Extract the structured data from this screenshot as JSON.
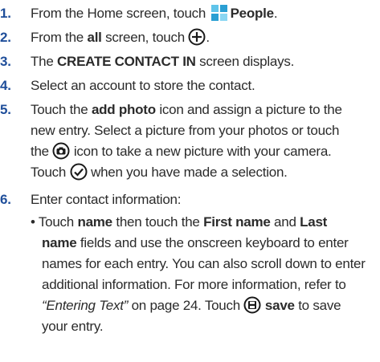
{
  "steps": [
    {
      "num": "1.",
      "lines": [
        [
          "From the Home screen, touch ",
          "People",
          "."
        ]
      ]
    },
    {
      "num": "2.",
      "lines": [
        [
          "From the ",
          "all",
          " screen, touch ",
          "."
        ]
      ]
    },
    {
      "num": "3.",
      "lines": [
        [
          "The ",
          "CREATE CONTACT IN",
          " screen displays."
        ]
      ]
    },
    {
      "num": "4.",
      "lines": [
        [
          "Select an account to store the contact."
        ]
      ]
    },
    {
      "num": "5.",
      "lines": [
        [
          "Touch the ",
          "add photo",
          " icon and assign a picture to the"
        ],
        [
          "new entry. Select a picture from your photos or touch"
        ],
        [
          "the ",
          " icon to take a new picture with your camera."
        ],
        [
          "Touch ",
          " when you have made a selection."
        ]
      ]
    },
    {
      "num": "6.",
      "lines": [
        [
          "Enter contact information:"
        ]
      ]
    }
  ],
  "bullet": {
    "lines": [
      [
        "• Touch ",
        "name",
        " then touch the ",
        "First name",
        " and ",
        "Last"
      ],
      [
        "name",
        " fields and use the onscreen keyboard to enter"
      ],
      [
        "names for each entry. You can also scroll down to enter"
      ],
      [
        "additional information. For more information, refer to"
      ],
      [
        "“Entering Text”",
        " on page 24. Touch ",
        "save",
        " to save"
      ],
      [
        "your entry."
      ]
    ]
  },
  "icons": {
    "people": "people-app-icon",
    "add": "add-circle-icon",
    "camera": "camera-circle-icon",
    "check": "check-circle-icon",
    "save": "save-disk-icon"
  },
  "colors": {
    "step_number": "#1f4e9a",
    "people_icon": "#3ab0de"
  }
}
